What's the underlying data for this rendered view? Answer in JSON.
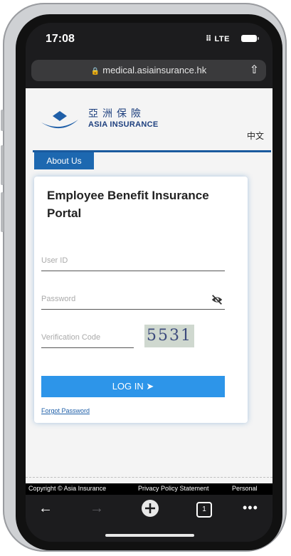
{
  "status_bar": {
    "time": "17:08",
    "network": "LTE"
  },
  "browser": {
    "url": "medical.asiainsurance.hk",
    "lock_icon": "lock-icon",
    "share_icon": "share-icon"
  },
  "header": {
    "logo_zh": "亞洲保險",
    "logo_en": "ASIA INSURANCE",
    "lang_toggle": "中文"
  },
  "nav": {
    "about_tab": "About Us"
  },
  "login": {
    "title": "Employee Benefit Insurance Portal",
    "user_id_placeholder": "User ID",
    "password_placeholder": "Password",
    "verification_placeholder": "Verification Code",
    "captcha_code": "5531",
    "login_button": "LOG IN",
    "forgot_password": "Forgot Password"
  },
  "footer": {
    "copyright": "Copyright © Asia Insurance",
    "privacy": "Privacy Policy Statement",
    "personal": "Personal"
  },
  "toolbar": {
    "back_icon": "back-arrow-icon",
    "forward_icon": "forward-arrow-icon",
    "new_tab_icon": "plus-icon",
    "tabs_count": "1",
    "more_icon": "more-icon"
  },
  "colors": {
    "brand_blue": "#1d68b0",
    "button_blue": "#2d95e9",
    "logo_navy": "#1d3f7e"
  }
}
